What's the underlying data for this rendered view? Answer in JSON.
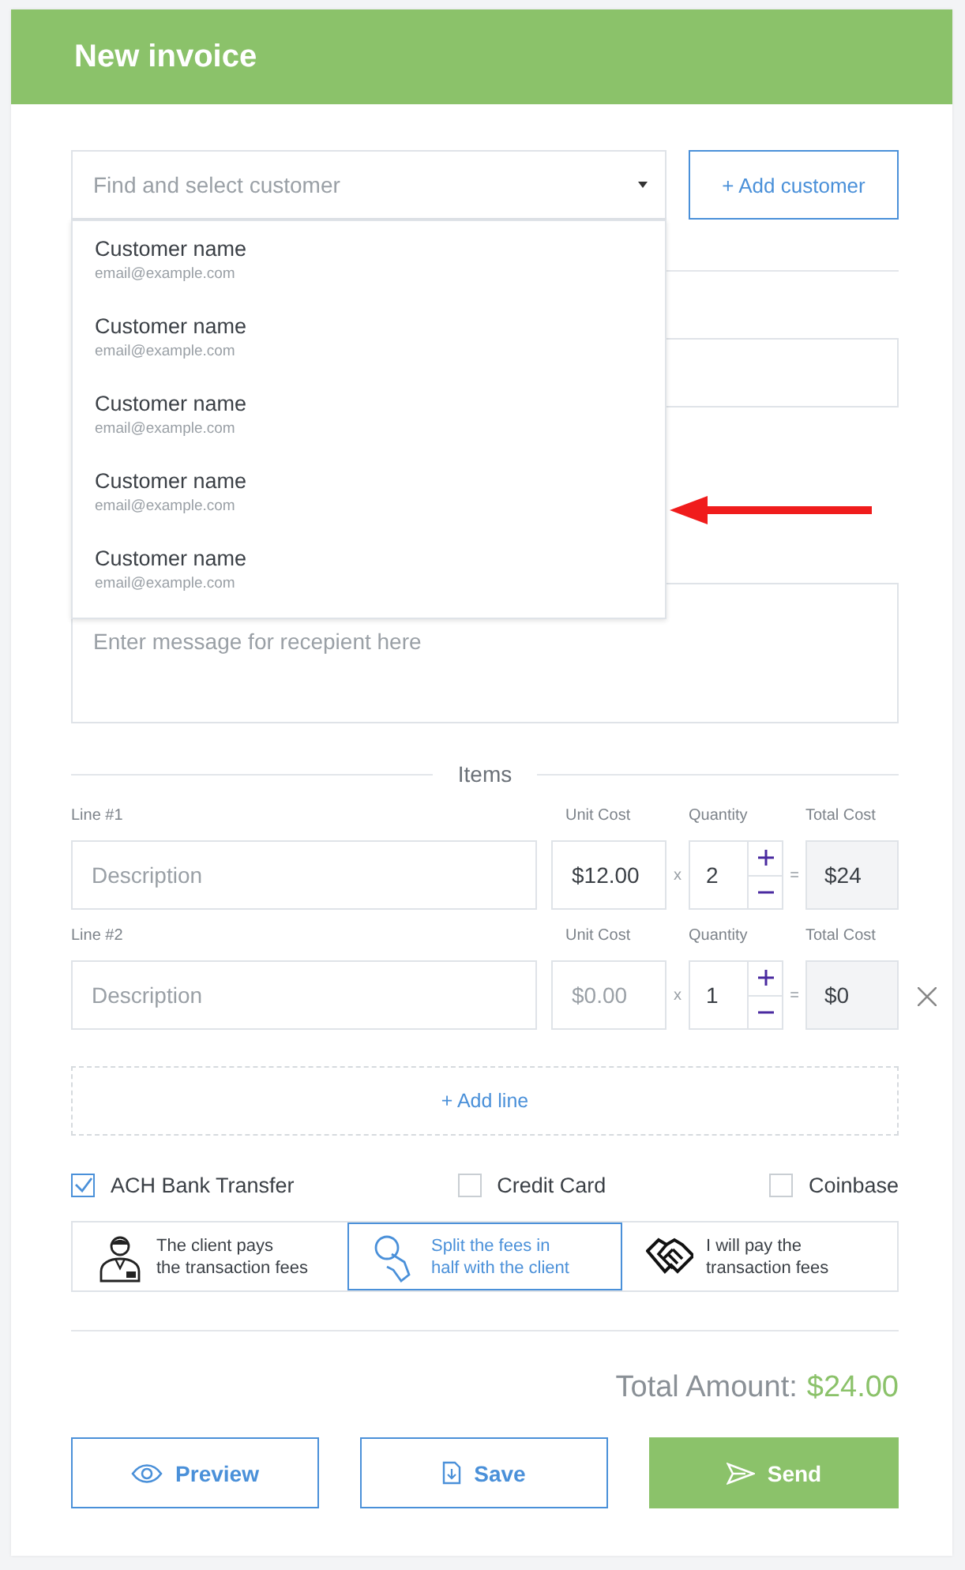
{
  "header": {
    "title": "New invoice"
  },
  "customer_select": {
    "placeholder": "Find and select customer",
    "expanded": true,
    "options": [
      {
        "name": "Customer name",
        "email": "email@example.com"
      },
      {
        "name": "Customer name",
        "email": "email@example.com"
      },
      {
        "name": "Customer name",
        "email": "email@example.com"
      },
      {
        "name": "Customer name",
        "email": "email@example.com"
      },
      {
        "name": "Customer name",
        "email": "email@example.com"
      }
    ]
  },
  "add_customer_button": "+ Add customer",
  "message": {
    "placeholder": "Enter message for recepient here"
  },
  "items_heading": "Items",
  "line_items": [
    {
      "label": "Line #1",
      "description_placeholder": "Description",
      "unit_cost_label": "Unit Cost",
      "unit_cost": "$12.00",
      "times_sign": "x",
      "quantity_label": "Quantity",
      "quantity": "2",
      "equals_sign": "=",
      "total_label": "Total Cost",
      "total": "$24"
    },
    {
      "label": "Line #2",
      "description_placeholder": "Description",
      "unit_cost_label": "Unit Cost",
      "unit_cost_placeholder": "$0.00",
      "times_sign": "x",
      "quantity_label": "Quantity",
      "quantity": "1",
      "equals_sign": "=",
      "total_label": "Total Cost",
      "total": "$0",
      "removable": true
    }
  ],
  "add_line_button": "+ Add line",
  "payment_methods": [
    {
      "label": "ACH Bank Transfer",
      "checked": true
    },
    {
      "label": "Credit Card",
      "checked": false
    },
    {
      "label": "Coinbase",
      "checked": false
    }
  ],
  "fee_options": [
    {
      "kind": "client",
      "lines": [
        "The client pays",
        "the transaction fees"
      ],
      "selected": false
    },
    {
      "kind": "split",
      "lines": [
        "Split the fees in",
        "half with the client"
      ],
      "selected": true
    },
    {
      "kind": "me",
      "lines": [
        "I will pay the",
        "transaction fees"
      ],
      "selected": false
    }
  ],
  "total": {
    "label": "Total Amount:",
    "amount": "$24.00"
  },
  "actions": [
    {
      "kind": "preview",
      "label": "Preview"
    },
    {
      "kind": "save",
      "label": "Save"
    },
    {
      "kind": "send",
      "label": "Send"
    }
  ]
}
